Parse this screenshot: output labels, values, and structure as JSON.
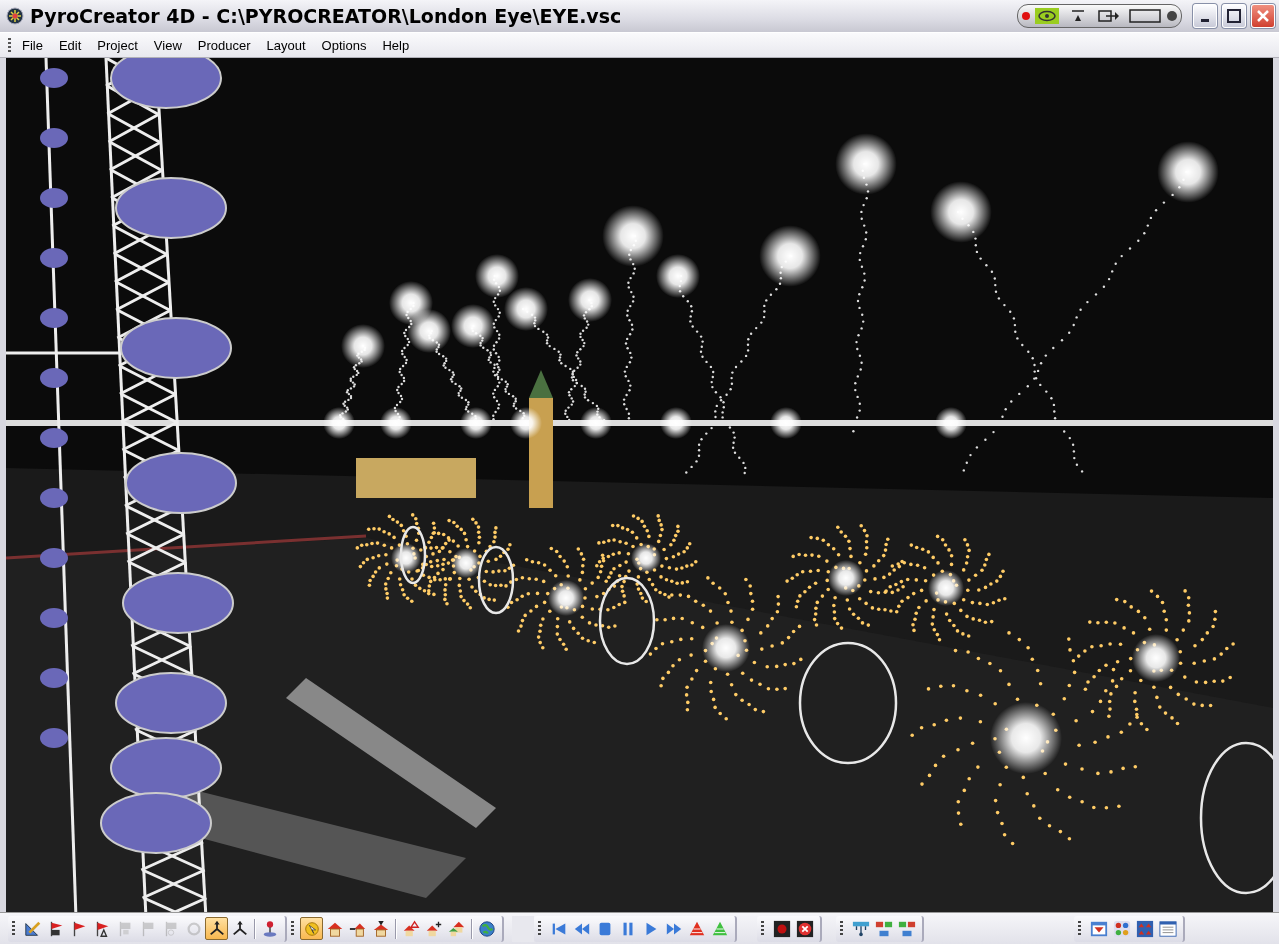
{
  "window": {
    "title": "PyroCreator 4D - C:\\PYROCREATOR\\London Eye\\EYE.vsc"
  },
  "menu": [
    {
      "label": "File"
    },
    {
      "label": "Edit"
    },
    {
      "label": "Project"
    },
    {
      "label": "View"
    },
    {
      "label": "Producer"
    },
    {
      "label": "Layout"
    },
    {
      "label": "Options"
    },
    {
      "label": "Help"
    }
  ],
  "toolbar": {
    "groups": [
      {
        "sections": [
          [
            {
              "selected": false,
              "disabled": false
            },
            {
              "selected": false,
              "disabled": false
            },
            {
              "selected": false,
              "disabled": false
            },
            {
              "selected": false,
              "disabled": false
            },
            {
              "selected": false,
              "disabled": true
            },
            {
              "selected": false,
              "disabled": true
            },
            {
              "selected": false,
              "disabled": true
            },
            {
              "selected": false,
              "disabled": true
            },
            {
              "selected": true,
              "disabled": false
            },
            {
              "selected": false,
              "disabled": false
            }
          ],
          [
            {
              "selected": false,
              "disabled": false
            }
          ]
        ]
      },
      {
        "sections": [
          [
            {
              "selected": true,
              "disabled": false
            },
            {
              "selected": false,
              "disabled": false
            },
            {
              "selected": false,
              "disabled": false
            },
            {
              "selected": false,
              "disabled": false
            }
          ],
          [
            {
              "selected": false,
              "disabled": false
            },
            {
              "selected": false,
              "disabled": false
            },
            {
              "selected": false,
              "disabled": false
            }
          ],
          [
            {
              "selected": false,
              "disabled": false
            }
          ]
        ]
      },
      {
        "sections": [
          [
            {
              "selected": false,
              "disabled": false
            },
            {
              "selected": false,
              "disabled": false
            },
            {
              "selected": false,
              "disabled": false
            },
            {
              "selected": false,
              "disabled": false
            },
            {
              "selected": false,
              "disabled": false
            },
            {
              "selected": false,
              "disabled": false
            },
            {
              "selected": false,
              "disabled": false
            },
            {
              "selected": false,
              "disabled": false
            }
          ]
        ]
      },
      {
        "sections": [
          [
            {
              "selected": false,
              "disabled": false
            },
            {
              "selected": false,
              "disabled": false
            }
          ]
        ]
      },
      {
        "sections": [
          [
            {
              "selected": false,
              "disabled": false
            },
            {
              "selected": false,
              "disabled": false
            },
            {
              "selected": false,
              "disabled": false
            }
          ]
        ]
      },
      {
        "sections": [
          [
            {
              "selected": false,
              "disabled": false
            },
            {
              "selected": false,
              "disabled": false
            },
            {
              "selected": false,
              "disabled": false
            },
            {
              "selected": false,
              "disabled": false
            }
          ]
        ]
      }
    ]
  }
}
